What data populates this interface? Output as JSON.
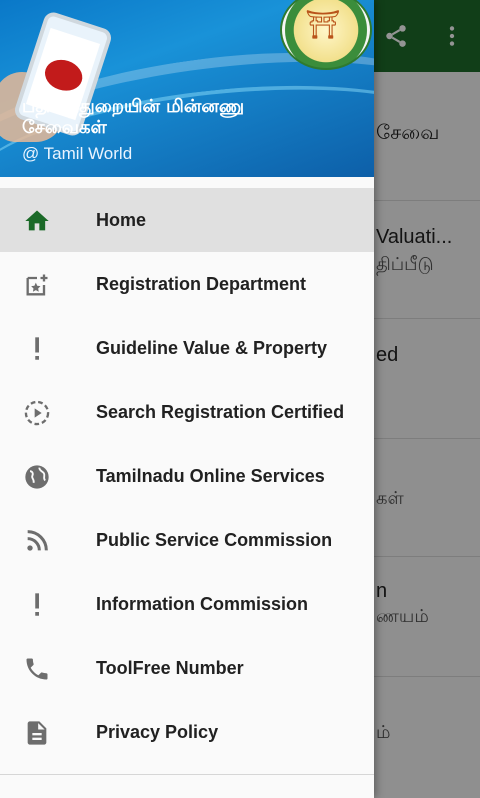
{
  "background_app": {
    "rows": [
      {
        "title": "சேவை",
        "sub": ""
      },
      {
        "title": "Valuati...",
        "sub": "திப்பீடு"
      },
      {
        "title": "ed",
        "sub": ""
      },
      {
        "title": "",
        "sub": "கள்"
      },
      {
        "title": "n",
        "sub": "ணயம்"
      },
      {
        "title": "",
        "sub": "ம்"
      }
    ],
    "actions": [
      "share-icon",
      "more-vert-icon"
    ]
  },
  "drawer": {
    "header": {
      "title": "பதிவுத்துறையின் மின்னணு சேவைகள்",
      "subtitle": "@ Tamil World"
    },
    "items": [
      {
        "label": "Home",
        "icon": "home-icon",
        "active": true
      },
      {
        "label": "Registration Department",
        "icon": "add-photo-icon",
        "active": false
      },
      {
        "label": "Guideline Value & Property",
        "icon": "exclamation-icon",
        "active": false
      },
      {
        "label": "Search Registration Certified",
        "icon": "slow-motion-video-icon",
        "active": false
      },
      {
        "label": "Tamilnadu Online Services",
        "icon": "globe-icon",
        "active": false
      },
      {
        "label": "Public Service Commission",
        "icon": "rss-feed-icon",
        "active": false
      },
      {
        "label": "Information Commission",
        "icon": "exclamation-icon",
        "active": false
      },
      {
        "label": "ToolFree Number",
        "icon": "phone-icon",
        "active": false
      },
      {
        "label": "Privacy Policy",
        "icon": "description-icon",
        "active": false
      }
    ]
  },
  "colors": {
    "accent": "#1b6a28",
    "appbar": "#1e6b2a"
  }
}
